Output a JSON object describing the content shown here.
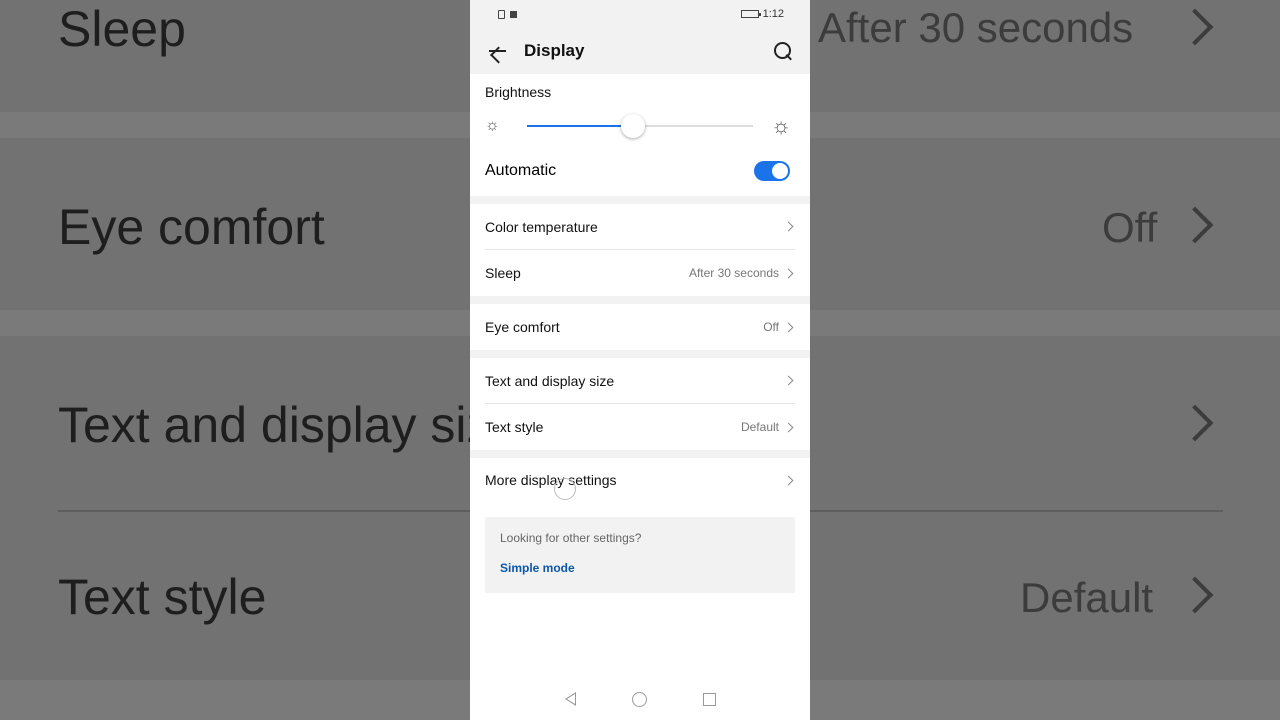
{
  "status_bar": {
    "time": "1:12"
  },
  "header": {
    "title": "Display"
  },
  "brightness": {
    "label": "Brightness",
    "level_percent": 47
  },
  "automatic": {
    "label": "Automatic",
    "enabled": true
  },
  "group1": [
    {
      "label": "Color temperature",
      "value": ""
    },
    {
      "label": "Sleep",
      "value": "After 30 seconds"
    }
  ],
  "group2": [
    {
      "label": "Eye comfort",
      "value": "Off"
    }
  ],
  "group3": [
    {
      "label": "Text and display size",
      "value": ""
    },
    {
      "label": "Text style",
      "value": "Default"
    }
  ],
  "more": {
    "label": "More display settings"
  },
  "hint": {
    "text": "Looking for other settings?",
    "link": "Simple mode"
  },
  "colors": {
    "accent": "#1a73e8",
    "link": "#0b57a8",
    "background": "#f2f2f2"
  },
  "icons": {
    "back": "back-arrow-icon",
    "search": "search-icon",
    "sun_small": "sun-small-icon",
    "sun_large": "sun-large-icon",
    "chevron": "chevron-right-icon"
  }
}
